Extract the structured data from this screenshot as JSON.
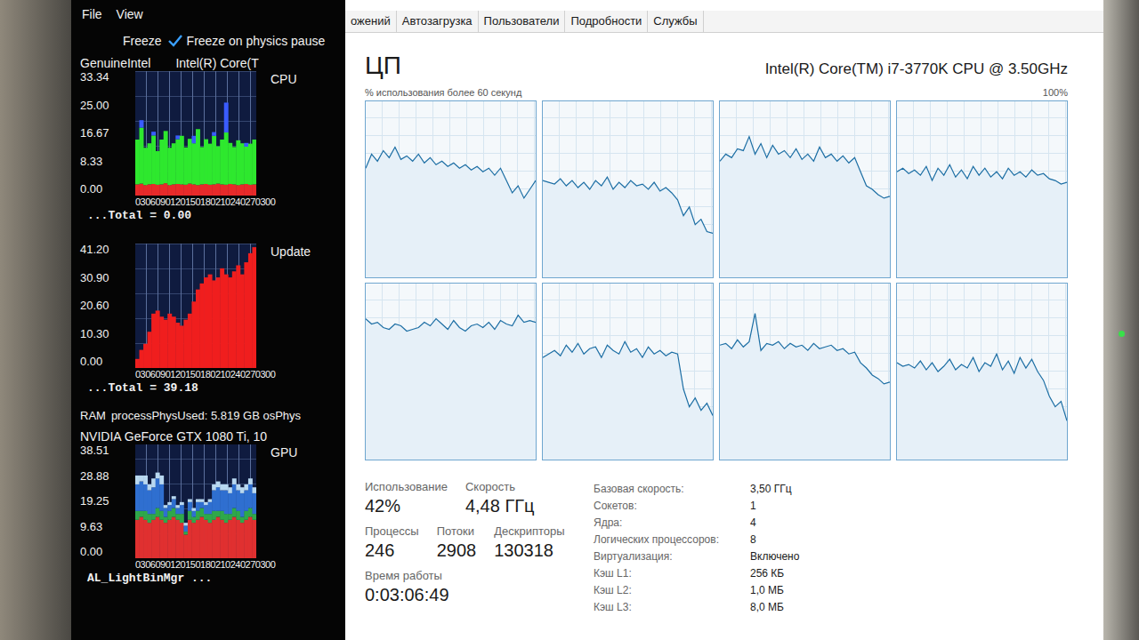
{
  "overlay": {
    "menu": [
      "File",
      "View"
    ],
    "options": [
      {
        "label": "Freeze",
        "checked": false
      },
      {
        "label": "Freeze on physics pause",
        "checked": true
      }
    ],
    "cpu_chart": {
      "vendor": "GenuineIntel",
      "model": "Intel(R) Core(T",
      "label": "CPU",
      "y_ticks": [
        "33.34",
        "25.00",
        "16.67",
        "8.33",
        "0.00"
      ],
      "x_axis": "0306090120150180210240270300",
      "total": "...Total = 0.00",
      "series": [
        {
          "name": "red",
          "color": "#e82a2a",
          "values": [
            3,
            3.2,
            2.8,
            3,
            3.1,
            2.9,
            3,
            3.3,
            2.8,
            3,
            3.1,
            3,
            2.9,
            3.2,
            3,
            2.8,
            3,
            3.1,
            2.9,
            3,
            3.2,
            3,
            2.9,
            3.1,
            3,
            2.8,
            3,
            3.1,
            2.9,
            3
          ]
        },
        {
          "name": "green",
          "color": "#2ee82e",
          "values": [
            12,
            15,
            10,
            11,
            13,
            9,
            12,
            14,
            10,
            11,
            12,
            13,
            10,
            12,
            11,
            15,
            10,
            12,
            11,
            13,
            10,
            12,
            14,
            11,
            10,
            12,
            11,
            10,
            11,
            12
          ]
        },
        {
          "name": "blue",
          "color": "#3a5cff",
          "values": [
            0,
            2,
            0,
            0,
            1,
            0,
            0,
            0,
            0,
            0,
            1,
            0,
            0,
            0,
            2,
            0,
            0,
            0,
            0,
            1,
            0,
            0,
            8,
            0,
            0,
            0,
            0,
            1,
            0,
            0
          ]
        }
      ]
    },
    "update_chart": {
      "label": "Update",
      "y_ticks": [
        "41.20",
        "30.90",
        "20.60",
        "10.30",
        "0.00"
      ],
      "x_axis": "0306090120150180210240270300",
      "total": "...Total = 39.18",
      "series": [
        {
          "name": "update",
          "color": "#f01e1e",
          "values": [
            3,
            6,
            8,
            12,
            18,
            19,
            17,
            16,
            18,
            17,
            15,
            14,
            16,
            18,
            22,
            26,
            28,
            30,
            31,
            29,
            30,
            33,
            31,
            30,
            32,
            34,
            31,
            35,
            38,
            40
          ]
        }
      ]
    },
    "ram": {
      "label": "RAM",
      "text": "processPhysUsed: 5.819 GB osPhys"
    },
    "gpu_chart": {
      "device": "NVIDIA GeForce GTX 1080 Ti, 10",
      "label": "GPU",
      "y_ticks": [
        "38.51",
        "28.88",
        "19.25",
        "9.63",
        "0.00"
      ],
      "x_axis": "0306090120150180210240270300",
      "caption": "AL_LightBinMgr ...",
      "series": [
        {
          "name": "red",
          "color": "#e03030",
          "values": [
            13,
            14,
            13,
            12,
            13,
            14,
            13,
            12,
            13,
            14,
            13,
            12,
            8,
            13,
            12,
            13,
            14,
            13,
            12,
            13,
            14,
            13,
            12,
            13,
            14,
            13,
            12,
            13,
            14,
            13
          ]
        },
        {
          "name": "green",
          "color": "#2fa84a",
          "values": [
            3,
            2,
            3,
            3,
            2,
            3,
            3,
            2,
            3,
            3,
            2,
            3,
            1,
            3,
            2,
            3,
            3,
            2,
            3,
            3,
            2,
            3,
            3,
            2,
            3,
            3,
            2,
            3,
            3,
            2
          ]
        },
        {
          "name": "blue",
          "color": "#2f6fd0",
          "values": [
            9,
            10,
            9,
            8,
            9,
            10,
            9,
            3,
            2,
            3,
            2,
            3,
            2,
            3,
            2,
            3,
            2,
            3,
            4,
            7,
            8,
            7,
            8,
            7,
            8,
            7,
            8,
            7,
            8,
            7
          ]
        },
        {
          "name": "light",
          "color": "#b8d8f0",
          "values": [
            3,
            2,
            3,
            2,
            3,
            2,
            3,
            1,
            1,
            1,
            1,
            1,
            1,
            1,
            1,
            1,
            1,
            1,
            1,
            2,
            2,
            2,
            2,
            2,
            2,
            2,
            2,
            2,
            2,
            2
          ]
        }
      ]
    }
  },
  "task_manager": {
    "tabs": [
      {
        "label": "ожений",
        "selected": false
      },
      {
        "label": "Автозагрузка",
        "selected": false
      },
      {
        "label": "Пользователи",
        "selected": false
      },
      {
        "label": "Подробности",
        "selected": false
      },
      {
        "label": "Службы",
        "selected": false
      }
    ],
    "title": "ЦП",
    "cpu_name": "Intel(R) Core(TM) i7-3770K CPU @ 3.50GHz",
    "graph_caption": "% использования более 60 секунд",
    "graph_max": "100%",
    "cores": [
      {
        "values": [
          62,
          70,
          66,
          72,
          68,
          74,
          67,
          69,
          66,
          70,
          65,
          68,
          64,
          66,
          63,
          65,
          62,
          64,
          61,
          63,
          60,
          62,
          58,
          62,
          55,
          48,
          52,
          45,
          50,
          55
        ]
      },
      {
        "values": [
          55,
          54,
          53,
          56,
          52,
          55,
          51,
          54,
          50,
          55,
          52,
          57,
          50,
          54,
          51,
          55,
          52,
          53,
          50,
          54,
          49,
          51,
          48,
          44,
          35,
          40,
          30,
          33,
          26,
          25
        ]
      },
      {
        "values": [
          66,
          70,
          68,
          73,
          72,
          80,
          70,
          76,
          68,
          75,
          70,
          72,
          68,
          73,
          67,
          70,
          66,
          74,
          68,
          70,
          66,
          69,
          65,
          68,
          60,
          52,
          50,
          47,
          45,
          46
        ]
      },
      {
        "values": [
          60,
          62,
          59,
          61,
          58,
          63,
          55,
          62,
          58,
          64,
          57,
          61,
          56,
          63,
          58,
          62,
          57,
          60,
          56,
          62,
          58,
          60,
          57,
          61,
          58,
          59,
          56,
          55,
          53,
          54
        ]
      },
      {
        "values": [
          80,
          77,
          78,
          75,
          74,
          77,
          76,
          73,
          74,
          75,
          78,
          76,
          80,
          77,
          74,
          79,
          75,
          73,
          76,
          77,
          75,
          78,
          74,
          79,
          77,
          76,
          82,
          78,
          79,
          78
        ]
      },
      {
        "values": [
          58,
          60,
          62,
          59,
          65,
          61,
          66,
          60,
          63,
          64,
          58,
          65,
          62,
          60,
          67,
          61,
          63,
          58,
          64,
          60,
          62,
          59,
          61,
          60,
          40,
          30,
          35,
          28,
          32,
          25
        ]
      },
      {
        "values": [
          65,
          66,
          63,
          68,
          64,
          67,
          83,
          62,
          66,
          65,
          67,
          63,
          66,
          64,
          65,
          62,
          66,
          63,
          64,
          65,
          62,
          63,
          60,
          61,
          55,
          52,
          48,
          46,
          43,
          44
        ]
      },
      {
        "values": [
          55,
          53,
          54,
          52,
          56,
          51,
          55,
          50,
          53,
          57,
          51,
          54,
          52,
          58,
          50,
          55,
          53,
          60,
          51,
          56,
          49,
          58,
          52,
          57,
          50,
          45,
          36,
          30,
          33,
          22
        ]
      }
    ],
    "stats": [
      [
        {
          "label": "Использование",
          "value": "42%"
        },
        {
          "label": "Скорость",
          "value": "4,48 ГГц"
        }
      ],
      [
        {
          "label": "Процессы",
          "value": "246"
        },
        {
          "label": "Потоки",
          "value": "2908"
        },
        {
          "label": "Дескрипторы",
          "value": "130318"
        }
      ],
      [
        {
          "label": "Время работы",
          "value": "0:03:06:49"
        }
      ]
    ],
    "specs": [
      {
        "label": "Базовая скорость:",
        "value": "3,50 ГГц"
      },
      {
        "label": "Сокетов:",
        "value": "1"
      },
      {
        "label": "Ядра:",
        "value": "4"
      },
      {
        "label": "Логических процессоров:",
        "value": "8"
      },
      {
        "label": "Виртуализация:",
        "value": "Включено"
      },
      {
        "label": "Кэш L1:",
        "value": "256 КБ"
      },
      {
        "label": "Кэш L2:",
        "value": "1,0 МБ"
      },
      {
        "label": "Кэш L3:",
        "value": "8,0 МБ"
      }
    ]
  }
}
